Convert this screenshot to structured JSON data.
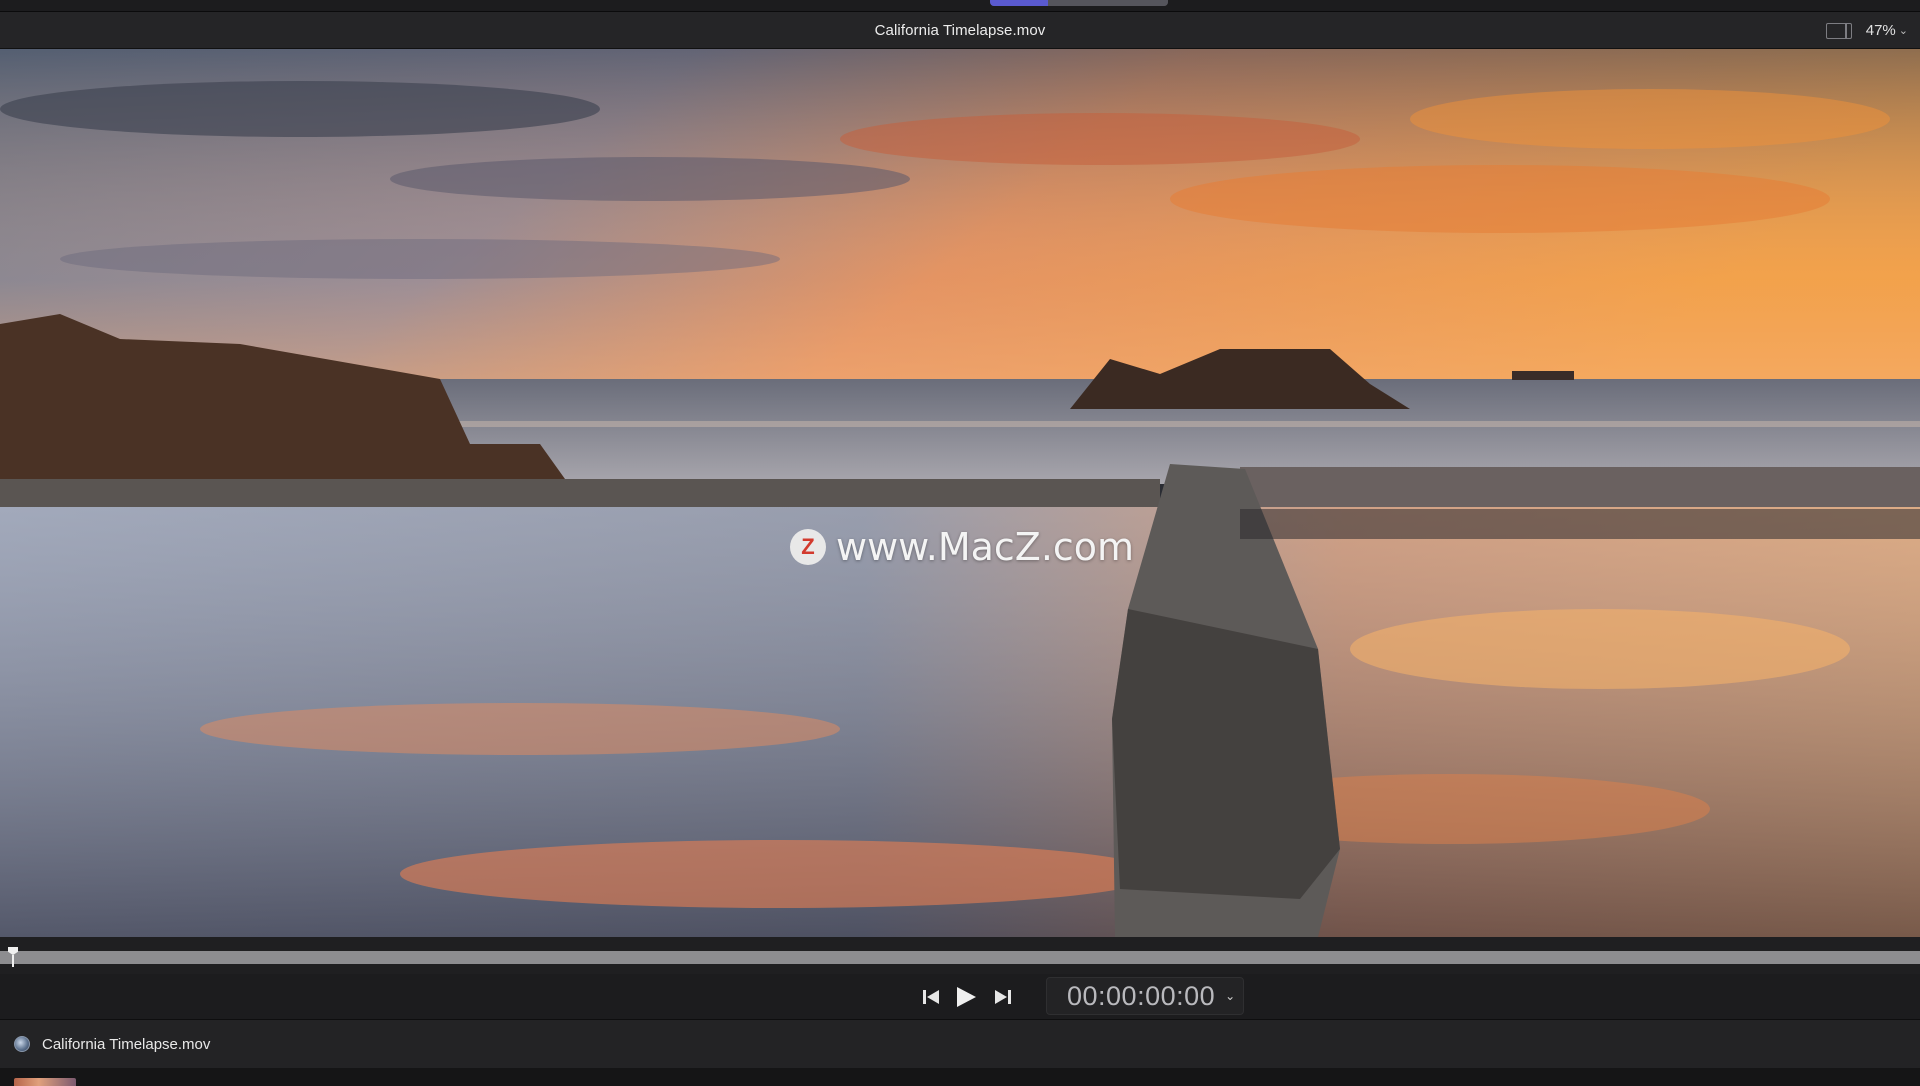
{
  "viewer": {
    "clip_title": "California Timelapse.mov",
    "zoom_level": "47%"
  },
  "watermark": {
    "logo_letter": "Z",
    "text": "www.MacZ.com"
  },
  "transport": {
    "timecode": "00:00:00:00"
  },
  "info_bar": {
    "clip_name": "California Timelapse.mov"
  },
  "playback": {
    "progress": 0
  },
  "icons": [
    "layout-toggle-icon",
    "chevron-down-icon",
    "skip-back-icon",
    "play-icon",
    "skip-forward-icon",
    "clip-icon"
  ],
  "colors": {
    "accent": "#5a5ad0",
    "scrub_bar": "#8d8d90",
    "background": "#1b1b1d"
  }
}
